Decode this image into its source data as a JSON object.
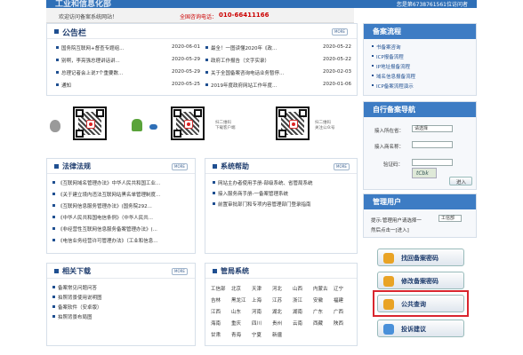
{
  "header": {
    "site_title": "工业和信息化部",
    "register_info": "您是第6738761561位访问者",
    "welcome": "欢迎访问备案系统网站！",
    "phone_label": "全国咨询电话：",
    "phone": "010-66411166"
  },
  "announcements": {
    "title": "公告栏",
    "more": "MORE",
    "left": [
      {
        "text": "国务院互联网+督查专题组...",
        "date": "2020-06-01"
      },
      {
        "text": "别啊，李亮强总理讲话讲...",
        "date": "2020-05-29"
      },
      {
        "text": "总理记者会上说7个重要数...",
        "date": "2020-05-29"
      },
      {
        "text": "通知",
        "date": "2020-05-25"
      }
    ],
    "right": [
      {
        "text": "最全！一图读懂2020年《政...",
        "date": "2020-05-22"
      },
      {
        "text": "政府工作报告（文字实录）",
        "date": "2020-05-22"
      },
      {
        "text": "关于全国备案咨询电话业务暂停...",
        "date": "2020-02-03"
      },
      {
        "text": "2019年度政府网站工作年度...",
        "date": "2020-01-06"
      }
    ]
  },
  "apps": {
    "qr1_caption": "扫二维码\n下载客户端",
    "qr2_caption": "扫二维码\n关注公众号"
  },
  "laws": {
    "title": "法律法规",
    "more": "MORE",
    "items": [
      "《互联网域名管理办法》中华人民共和国工业...",
      "《关于建立境内违法互联网站黑名单管理制度...",
      "《互联网信息服务管理办法》(国务院292...",
      "《中华人民共和国电信条例》（中华人民共...",
      "《非经营性互联网信息服务备案管理办法》(...",
      "《电信业务经营许可管理办法》（工业和信息..."
    ]
  },
  "help": {
    "title": "系统帮助",
    "more": "MORE",
    "items": [
      "网站主办者使用手册-部级系统、省管局系统",
      "接入服务商手册-一备案管理系统",
      "前置审批部门和专项内容管理部门登录指南"
    ]
  },
  "downloads": {
    "title": "相关下载",
    "more": "MORE",
    "items": [
      "备案常见问题问答",
      "拍照背景使用说明图",
      "备案软件（安卓版）",
      "拍照背景布局图"
    ]
  },
  "bureaus": {
    "title": "管局系统",
    "cells": [
      "工信部",
      "北京",
      "天津",
      "河北",
      "山西",
      "内蒙古",
      "辽宁",
      "吉林",
      "黑龙江",
      "上海",
      "江苏",
      "浙江",
      "安徽",
      "福建",
      "江西",
      "山东",
      "河南",
      "湖北",
      "湖南",
      "广东",
      "广西",
      "海南",
      "重庆",
      "四川",
      "贵州",
      "云南",
      "西藏",
      "陕西",
      "甘肃",
      "青海",
      "宁夏",
      "新疆"
    ]
  },
  "process": {
    "title": "备案流程",
    "items": [
      "书备案咨询",
      "ICP报备流程",
      "IP地址报备流程",
      "域名信息报备流程",
      "ICP备案流程演示"
    ]
  },
  "nav": {
    "title": "自行备案导航",
    "province_label": "接入所在省：",
    "province_value": "请选择",
    "name_label": "接入商名称：",
    "code_label": "验证码：",
    "captcha": "tCbk",
    "enter": "进入"
  },
  "admin": {
    "title": "管理用户",
    "hint": "提示:管理用户请选择一",
    "select_value": "工信部",
    "then": "然后点击一[进入]"
  },
  "actions": [
    {
      "label": "找回备案密码",
      "color": "#e9a325"
    },
    {
      "label": "修改备案密码",
      "color": "#e9a325"
    },
    {
      "label": "公共查询",
      "color": "#e9a325"
    },
    {
      "label": "投诉建议",
      "color": "#4a90d9"
    }
  ],
  "highlight_color": "#d9262e"
}
